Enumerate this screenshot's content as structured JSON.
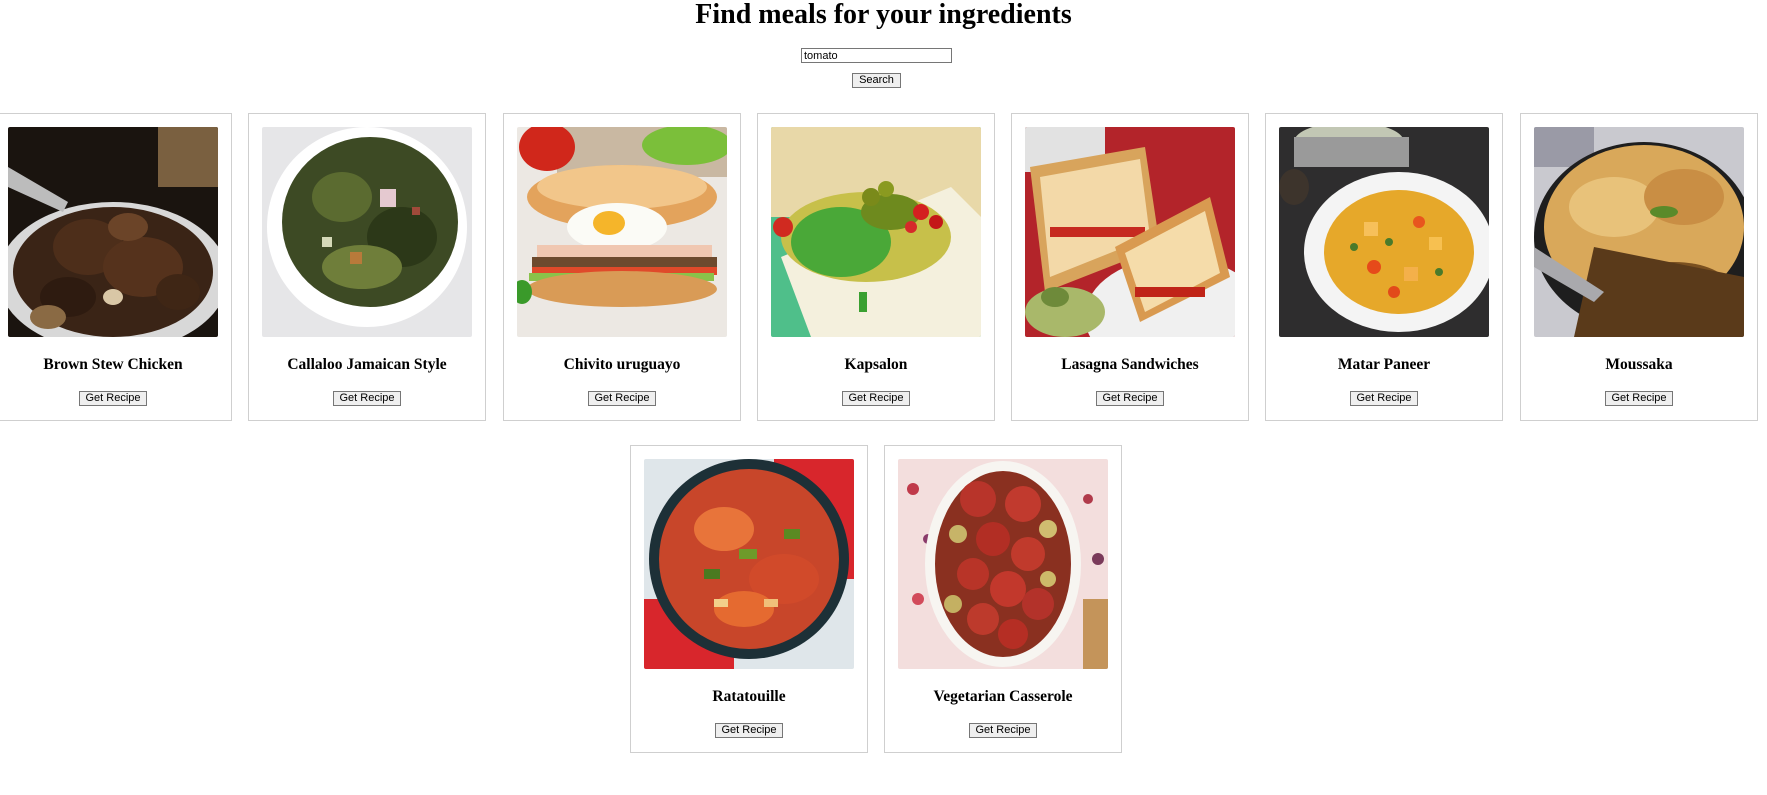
{
  "page": {
    "title": "Find meals for your ingredients"
  },
  "search": {
    "value": "tomato",
    "button_label": "Search"
  },
  "meals": [
    {
      "name": "Brown Stew Chicken",
      "button_label": "Get Recipe",
      "image": "brown-stew-chicken"
    },
    {
      "name": "Callaloo Jamaican Style",
      "button_label": "Get Recipe",
      "image": "callaloo-jamaican-style"
    },
    {
      "name": "Chivito uruguayo",
      "button_label": "Get Recipe",
      "image": "chivito-uruguayo"
    },
    {
      "name": "Kapsalon",
      "button_label": "Get Recipe",
      "image": "kapsalon"
    },
    {
      "name": "Lasagna Sandwiches",
      "button_label": "Get Recipe",
      "image": "lasagna-sandwiches"
    },
    {
      "name": "Matar Paneer",
      "button_label": "Get Recipe",
      "image": "matar-paneer"
    },
    {
      "name": "Moussaka",
      "button_label": "Get Recipe",
      "image": "moussaka"
    },
    {
      "name": "Ratatouille",
      "button_label": "Get Recipe",
      "image": "ratatouille"
    },
    {
      "name": "Vegetarian Casserole",
      "button_label": "Get Recipe",
      "image": "vegetarian-casserole"
    }
  ],
  "colors": {
    "card_border": "#cfcfcf",
    "button_bg": "#efefef",
    "button_border": "#767676"
  }
}
